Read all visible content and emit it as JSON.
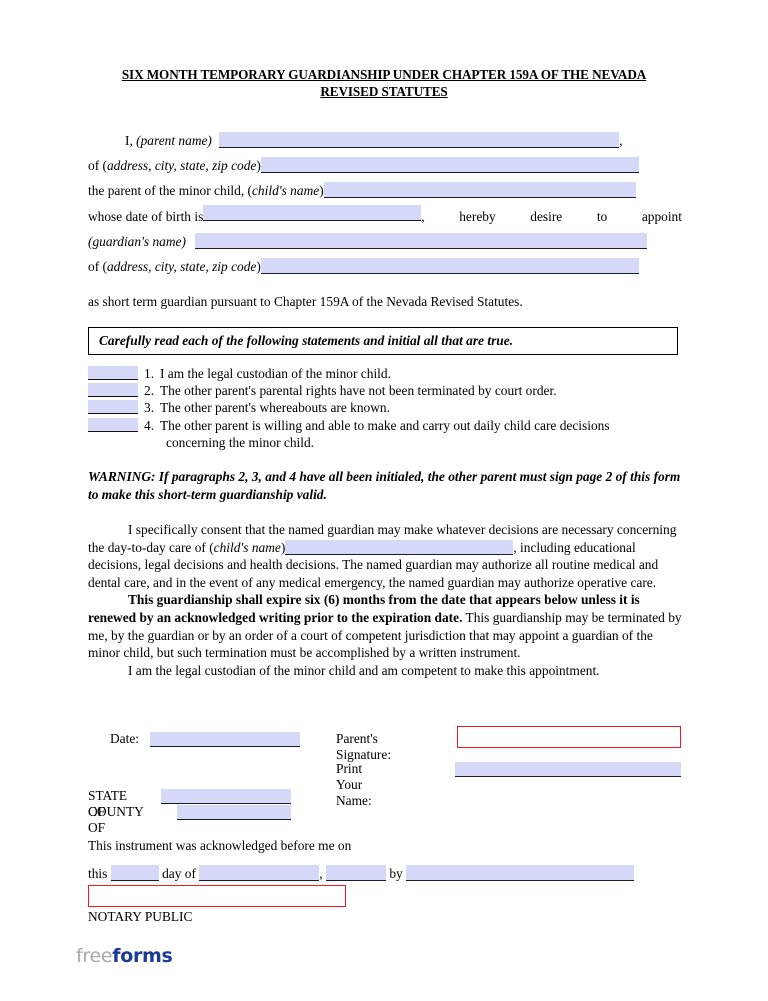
{
  "document": {
    "title_line1": "SIX MONTH TEMPORARY GUARDIANSHIP UNDER CHAPTER 159A OF THE NEVADA",
    "title_line2": "REVISED STATUTES"
  },
  "intro": {
    "l1_prefix": "I, ",
    "l1_italic": "(parent name)",
    "l1_suffix": ",",
    "l2_prefix": "of (",
    "l2_italic": "address, city, state, zip code",
    "l2_suffix": ")",
    "l3_prefix": "the parent of the minor child, (",
    "l3_italic": "child's name",
    "l3_suffix": ")",
    "l4_prefix": "whose date of birth is ",
    "l4_comma": ",",
    "l4_w1": "hereby",
    "l4_w2": "desire",
    "l4_w3": "to",
    "l4_w4": "appoint",
    "l5_italic": "(guardian's name)",
    "l6_prefix": "of (",
    "l6_italic": "address, city, state, zip code",
    "l6_suffix": ")",
    "closing_sentence": "as short term guardian pursuant to Chapter 159A of the Nevada Revised Statutes."
  },
  "callout": {
    "text": "Carefully read each of the following statements and initial all that are true."
  },
  "statements": [
    {
      "num": "1.",
      "text": "I am the legal custodian of the minor child.",
      "cont": ""
    },
    {
      "num": "2.",
      "text": "The other parent's parental rights have not been terminated by court order.",
      "cont": ""
    },
    {
      "num": "3.",
      "text": "The other parent's whereabouts are known.",
      "cont": ""
    },
    {
      "num": "4.",
      "text": "The other parent is willing and able to make and carry out daily child care decisions",
      "cont": "concerning the minor child."
    }
  ],
  "warning": {
    "text": "WARNING: If paragraphs 2, 3, and 4 have all been initialed, the other parent must sign page 2 of this form to make this short-term guardianship valid."
  },
  "body": {
    "p1_a": "I specifically consent that the named guardian may make whatever decisions are necessary concerning the day-to-day care of (",
    "p1_italic": "child's name",
    "p1_b": ")",
    "p1_c": ", including educational decisions, legal decisions and health decisions.  The named guardian may authorize all routine medical and dental care, and in the event of any medical emergency, the named guardian may authorize operative care.",
    "p2_bold": "This guardianship shall expire six (6) months from the date that appears below unless it is renewed by an acknowledged writing prior to the expiration date.",
    "p2_rest": "  This guardianship may be terminated by me, by the guardian or by an order of a court of competent jurisdiction that may appoint a guardian of the minor child, but such termination must be accomplished by a written instrument.",
    "p3": "I am the legal custodian of the minor child and am competent to make this appointment."
  },
  "signature": {
    "date_label": "Date:",
    "date_value": "",
    "parent_signature_label": "Parent's Signature:",
    "parent_signature_value": "",
    "print_name_label": "Print Your Name:",
    "print_name_value": "",
    "state_label": "STATE OF",
    "state_value": "",
    "county_label": "COUNTY OF",
    "county_value": ""
  },
  "notary": {
    "intro": "This instrument was acknowledged before me on",
    "this_label": "this",
    "day_value": "",
    "day_of_label": "day of",
    "month_value": "",
    "comma": ",",
    "year_value": "",
    "by_label": "by",
    "by_value": "",
    "seal_value": "",
    "notary_public_label": "NOTARY PUBLIC"
  },
  "footer": {
    "logo_part1": "free",
    "logo_part2": "forms"
  },
  "colors": {
    "field_fill": "#d5d9f7",
    "field_underline": "#1a1a33",
    "signature_border": "#ed1c24",
    "logo_gray": "#a8a8a8",
    "logo_blue": "#1b3a93"
  }
}
